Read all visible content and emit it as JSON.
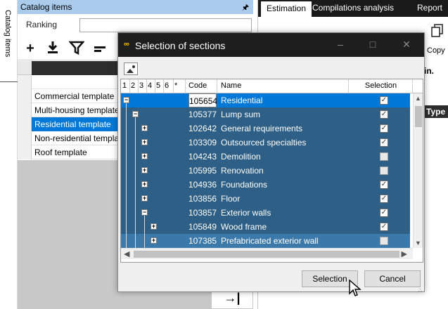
{
  "side_tab": {
    "label": "Catalog items"
  },
  "left_panel": {
    "title": "Catalog items",
    "pin_icon": "pin-icon",
    "ranking_label": "Ranking",
    "ranking_value": "",
    "toolbar": [
      "add-icon",
      "import-icon",
      "filter-icon",
      "minus-icon"
    ],
    "rows": [
      {
        "label": "Commercial template",
        "selected": false
      },
      {
        "label": "Multi-housing template",
        "selected": false
      },
      {
        "label": "Residential template",
        "selected": true
      },
      {
        "label": "Non-residential template",
        "selected": false
      },
      {
        "label": "Roof template",
        "selected": false
      }
    ]
  },
  "right_panel": {
    "tabs": [
      "Estimation",
      "Compilations analysis",
      "Report"
    ],
    "copy_label": "Copy",
    "min_label": "in.",
    "type_header": "Type",
    "bottom_icon": "→|"
  },
  "dialog": {
    "title": "Selection of sections",
    "level_buttons": [
      "1",
      "2",
      "3",
      "4",
      "5",
      "6",
      "*"
    ],
    "col_code": "Code",
    "col_name": "Name",
    "col_selection": "Selection",
    "rows": [
      {
        "code": "105654",
        "name": "Residential",
        "level": 0,
        "expand": "minus",
        "checked": true,
        "style": "sel"
      },
      {
        "code": "105377",
        "name": "Lump sum",
        "level": 1,
        "expand": "minus",
        "checked": true,
        "style": ""
      },
      {
        "code": "102642",
        "name": "General requirements",
        "level": 2,
        "expand": "plus",
        "checked": true,
        "style": ""
      },
      {
        "code": "103309",
        "name": "Outsourced specialties",
        "level": 2,
        "expand": "plus",
        "checked": true,
        "style": ""
      },
      {
        "code": "104243",
        "name": "Demolition",
        "level": 2,
        "expand": "plus",
        "checked": false,
        "style": ""
      },
      {
        "code": "105995",
        "name": "Renovation",
        "level": 2,
        "expand": "plus",
        "checked": false,
        "style": ""
      },
      {
        "code": "104936",
        "name": "Foundations",
        "level": 2,
        "expand": "plus",
        "checked": true,
        "style": ""
      },
      {
        "code": "103856",
        "name": "Floor",
        "level": 2,
        "expand": "plus",
        "checked": true,
        "style": ""
      },
      {
        "code": "103857",
        "name": "Exterior walls",
        "level": 2,
        "expand": "minus",
        "checked": true,
        "style": ""
      },
      {
        "code": "105849",
        "name": "Wood frame",
        "level": 3,
        "expand": "plus",
        "checked": true,
        "style": ""
      },
      {
        "code": "107385",
        "name": "Prefabricated exterior wall",
        "level": 3,
        "expand": "plus",
        "checked": false,
        "style": "alt"
      }
    ],
    "btn_selection": "Selection",
    "btn_cancel": "Cancel"
  }
}
